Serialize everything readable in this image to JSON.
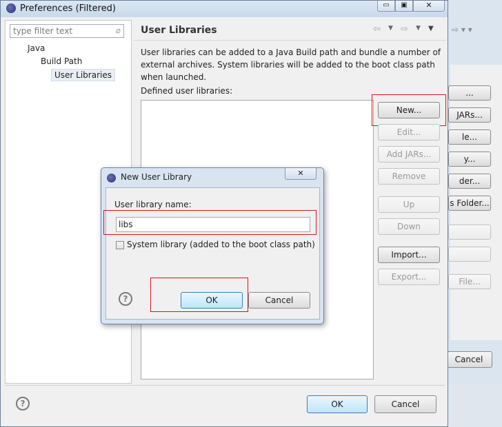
{
  "window": {
    "title": "Preferences (Filtered)"
  },
  "filter": {
    "placeholder": "type filter text"
  },
  "tree": {
    "items": [
      "Java",
      "Build Path",
      "User Libraries"
    ]
  },
  "page": {
    "title": "User Libraries",
    "description": "User libraries can be added to a Java Build path and bundle a number of external archives. System libraries will be added to the boot class path when launched.",
    "defined_label": "Defined user libraries:"
  },
  "side_buttons": {
    "new": "New...",
    "edit": "Edit...",
    "add_jars": "Add JARs...",
    "remove": "Remove",
    "up": "Up",
    "down": "Down",
    "import": "Import...",
    "export": "Export..."
  },
  "back_window": {
    "buttons": [
      "...",
      "JARs...",
      "le...",
      "y...",
      "der...",
      "s Folder...",
      "",
      "",
      "File...",
      "Cancel"
    ]
  },
  "dialog": {
    "title": "New User Library",
    "name_label": "User library name:",
    "name_value": "libs",
    "system_label": "System library (added to the boot class path)",
    "ok": "OK",
    "cancel": "Cancel"
  },
  "footer": {
    "ok": "OK",
    "cancel": "Cancel"
  }
}
